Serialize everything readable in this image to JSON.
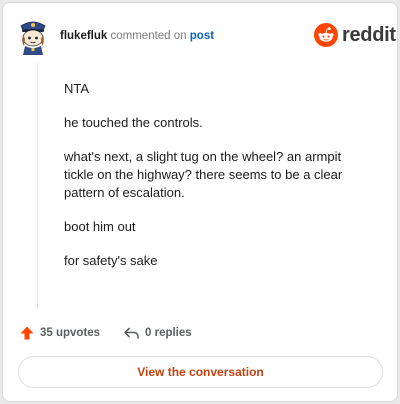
{
  "header": {
    "username": "flukefluk",
    "action_text": "commented on",
    "link_text": "post",
    "brand_name": "reddit"
  },
  "comment": {
    "paragraphs": [
      "NTA",
      "he touched the controls.",
      "what's next, a slight tug on the wheel? an armpit tickle on the highway? there seems to be a clear pattern of escalation.",
      "boot him out",
      "for safety's sake"
    ]
  },
  "footer": {
    "upvotes_label": "35 upvotes",
    "replies_label": "0 replies",
    "cta_label": "View the conversation"
  },
  "icons": {
    "avatar": "avatar-police-snoo",
    "brand": "reddit-snoo-icon",
    "upvote": "upvote-arrow-icon",
    "reply": "reply-arrow-icon"
  },
  "colors": {
    "brand_orange": "#ff4500",
    "upvote_orange": "#ff4500",
    "link_blue": "#0b63b6",
    "cta_text": "#c24310"
  }
}
